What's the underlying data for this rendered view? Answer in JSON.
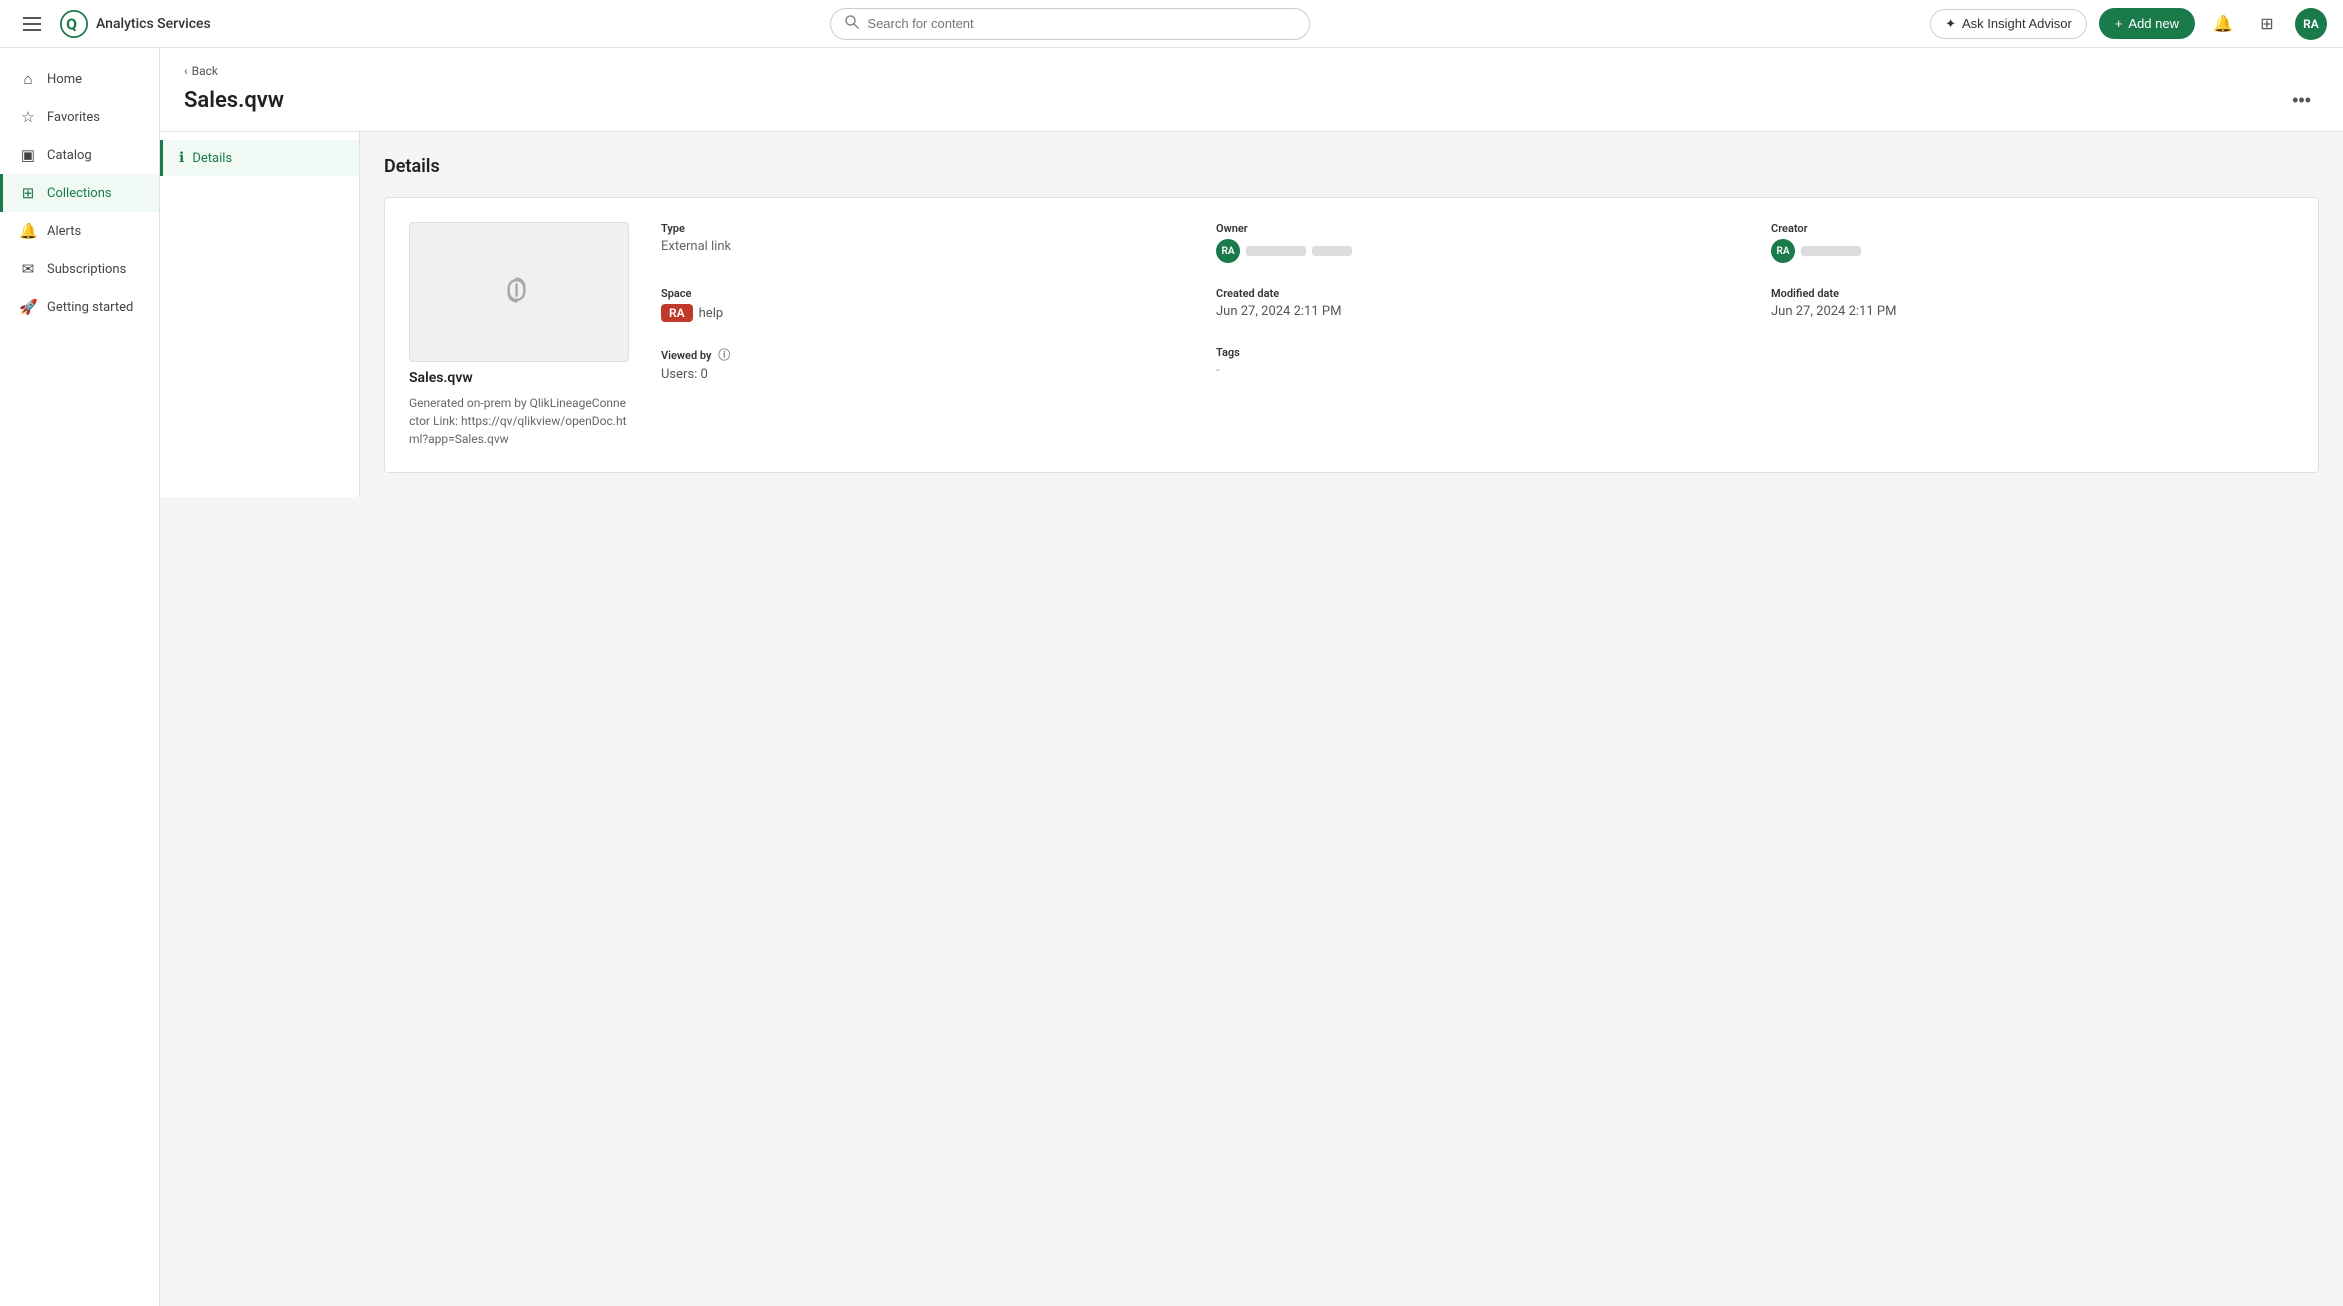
{
  "app": {
    "name": "Analytics Services"
  },
  "topnav": {
    "search_placeholder": "Search for content",
    "insight_advisor_label": "Ask Insight Advisor",
    "add_new_label": "Add new",
    "avatar_initials": "RA"
  },
  "sidebar": {
    "items": [
      {
        "id": "home",
        "label": "Home",
        "icon": "⌂"
      },
      {
        "id": "favorites",
        "label": "Favorites",
        "icon": "☆"
      },
      {
        "id": "catalog",
        "label": "Catalog",
        "icon": "▣"
      },
      {
        "id": "collections",
        "label": "Collections",
        "icon": "⊞",
        "active": true
      },
      {
        "id": "alerts",
        "label": "Alerts",
        "icon": "🔔"
      },
      {
        "id": "subscriptions",
        "label": "Subscriptions",
        "icon": "✉"
      },
      {
        "id": "getting_started",
        "label": "Getting started",
        "icon": "🚀"
      }
    ]
  },
  "page": {
    "back_label": "Back",
    "title": "Sales.qvw",
    "more_icon": "•••"
  },
  "left_panel": {
    "tabs": [
      {
        "id": "details",
        "label": "Details",
        "icon": "ℹ",
        "active": true
      }
    ]
  },
  "details": {
    "heading": "Details",
    "preview": {
      "name": "Sales.qvw",
      "description": "Generated on-prem by QlikLineageConnector Link: https://qv/qlikview/openDoc.html?app=Sales.qvw"
    },
    "type": {
      "label": "Type",
      "value": "External link"
    },
    "owner": {
      "label": "Owner",
      "initials": "RA"
    },
    "creator": {
      "label": "Creator",
      "initials": "RA"
    },
    "space": {
      "label": "Space",
      "badge_text": "RA",
      "name": "help"
    },
    "created_date": {
      "label": "Created date",
      "value": "Jun 27, 2024 2:11 PM"
    },
    "modified_date": {
      "label": "Modified date",
      "value": "Jun 27, 2024 2:11 PM"
    },
    "viewed_by": {
      "label": "Viewed by",
      "value": "Users: 0"
    },
    "tags": {
      "label": "Tags",
      "value": "-"
    }
  }
}
